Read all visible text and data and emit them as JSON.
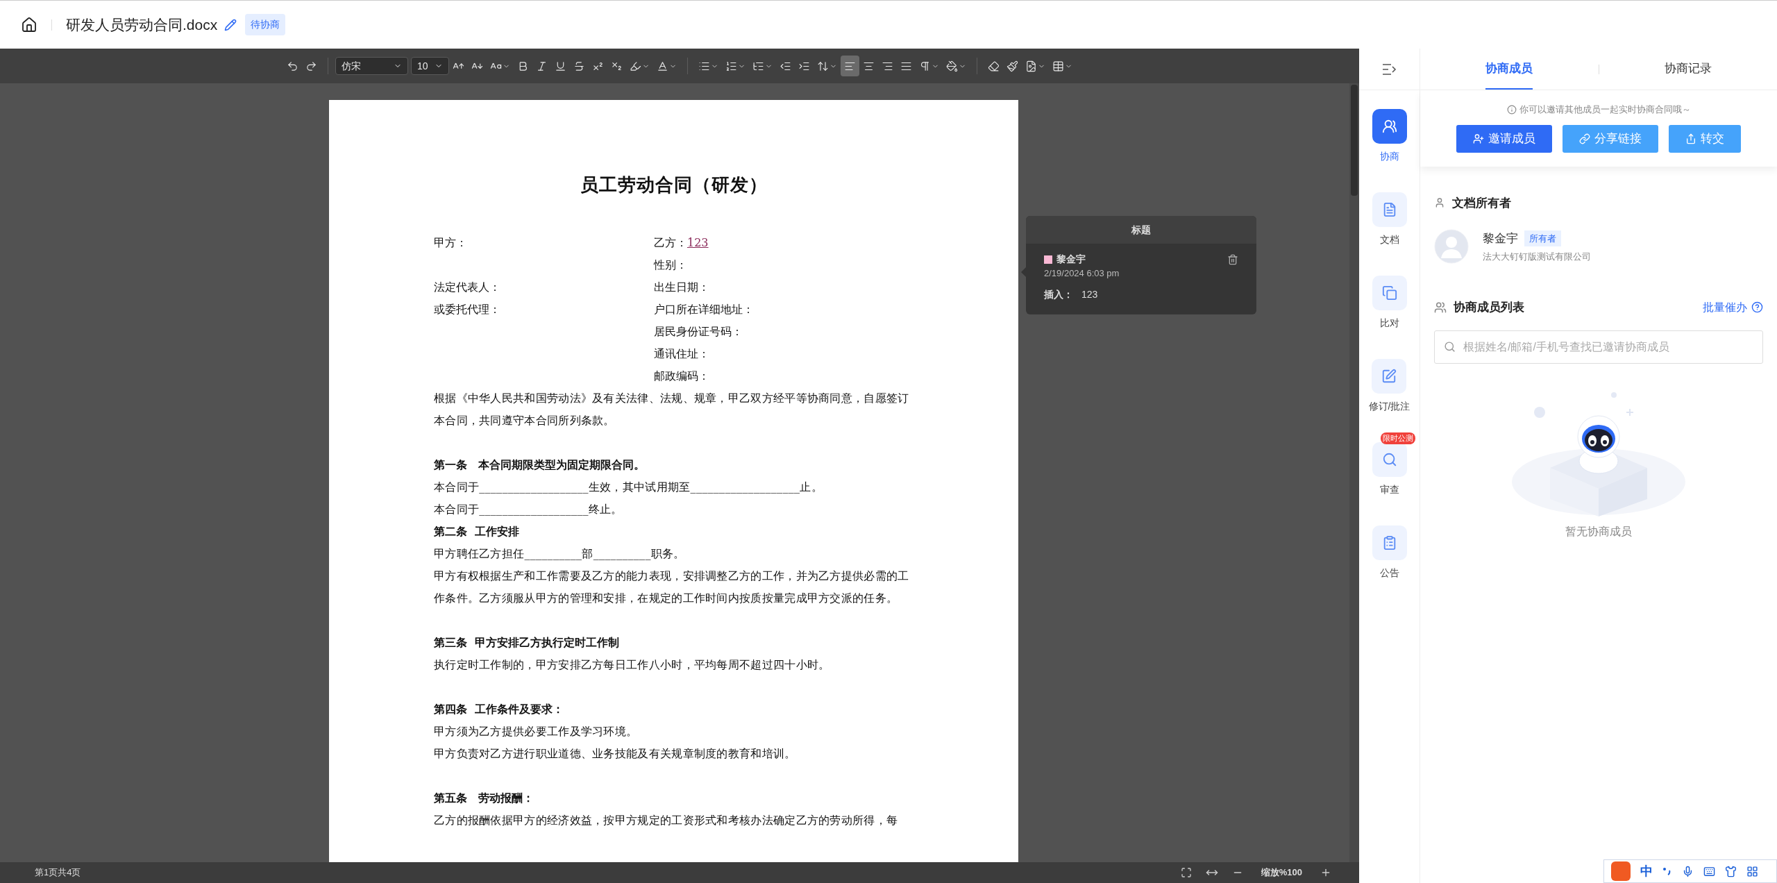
{
  "header": {
    "title": "研发人员劳动合同.docx",
    "status_tag": "待协商"
  },
  "toolbar": {
    "font": "仿宋",
    "size": "10",
    "alignment": [
      {
        "selected": true
      },
      {
        "selected": false
      },
      {
        "selected": false
      },
      {
        "selected": false
      }
    ]
  },
  "document": {
    "title": "员工劳动合同（研发）",
    "fields": [
      {
        "left": "甲方：",
        "right": "乙方：",
        "inserted": "123"
      },
      {
        "right": "性别："
      },
      {
        "left": "法定代表人：",
        "right": "出生日期："
      },
      {
        "left": "或委托代理：",
        "right": "户口所在详细地址："
      },
      {
        "right": "居民身份证号码："
      },
      {
        "right": "通讯住址："
      },
      {
        "right": "邮政编码："
      }
    ],
    "paragraphs": [
      {
        "kind": "text",
        "text": "根据《中华人民共和国劳动法》及有关法律、法规、规章，甲乙双方经平等协商同意，自愿签订本合同，共同遵守本合同所列条款。"
      },
      {
        "kind": "blank"
      },
      {
        "kind": "heading",
        "text": "第一条　本合同期限类型为固定期限合同。"
      },
      {
        "kind": "text",
        "text": "本合同于___________________生效，其中试用期至___________________止。"
      },
      {
        "kind": "text",
        "text": "本合同于___________________终止。"
      },
      {
        "kind": "heading",
        "text": "第二条  工作安排"
      },
      {
        "kind": "text",
        "text": "甲方聘任乙方担任__________部__________职务。"
      },
      {
        "kind": "text",
        "text": "甲方有权根据生产和工作需要及乙方的能力表现，安排调整乙方的工作，并为乙方提供必需的工作条件。乙方须服从甲方的管理和安排，在规定的工作时间内按质按量完成甲方交派的任务。"
      },
      {
        "kind": "blank"
      },
      {
        "kind": "heading",
        "text": "第三条  甲方安排乙方执行定时工作制"
      },
      {
        "kind": "text",
        "text": "执行定时工作制的，甲方安排乙方每日工作八小时，平均每周不超过四十小时。"
      },
      {
        "kind": "blank"
      },
      {
        "kind": "heading",
        "text": "第四条  工作条件及要求："
      },
      {
        "kind": "text",
        "text": "甲方须为乙方提供必要工作及学习环境。"
      },
      {
        "kind": "text",
        "text": "甲方负责对乙方进行职业道德、业务技能及有关规章制度的教育和培训。"
      },
      {
        "kind": "blank"
      },
      {
        "kind": "heading",
        "text": "第五条　劳动报酬："
      },
      {
        "kind": "text",
        "text": "乙方的报酬依据甲方的经济效益，按甲方规定的工资形式和考核办法确定乙方的劳动所得，每"
      }
    ]
  },
  "comment": {
    "title": "标题",
    "author": "黎金宇",
    "color": "#f9b8d4",
    "date": "2/19/2024 6:03 pm",
    "action": "插入：",
    "value": "123"
  },
  "status_bar": {
    "page": "第1页共4页",
    "zoom": "缩放%100"
  },
  "side_nav": [
    {
      "label": "协商",
      "selected": true
    },
    {
      "label": "文档",
      "selected": false
    },
    {
      "label": "比对",
      "selected": false
    },
    {
      "label": "修订/批注",
      "selected": false
    },
    {
      "label": "审查",
      "selected": false,
      "badge": "限时公测"
    },
    {
      "label": "公告",
      "selected": false
    }
  ],
  "panel": {
    "tabs": [
      {
        "label": "协商成员",
        "selected": true
      },
      {
        "label": "协商记录",
        "selected": false
      }
    ],
    "hint": "你可以邀请其他成员一起实时协商合同哦～",
    "buttons": [
      {
        "label": "邀请成员",
        "kind": "primary"
      },
      {
        "label": "分享链接",
        "kind": "secondary"
      },
      {
        "label": "转交",
        "kind": "secondary"
      }
    ],
    "owner": {
      "heading": "文档所有者",
      "name": "黎金宇",
      "tag": "所有者",
      "company": "法大大钉钉版测试有限公司"
    },
    "members": {
      "heading": "协商成员列表",
      "action": "批量催办",
      "placeholder": "根据姓名/邮箱/手机号查找已邀请协商成员",
      "empty": "暂无协商成员"
    }
  },
  "ime": {
    "mode": "中"
  }
}
